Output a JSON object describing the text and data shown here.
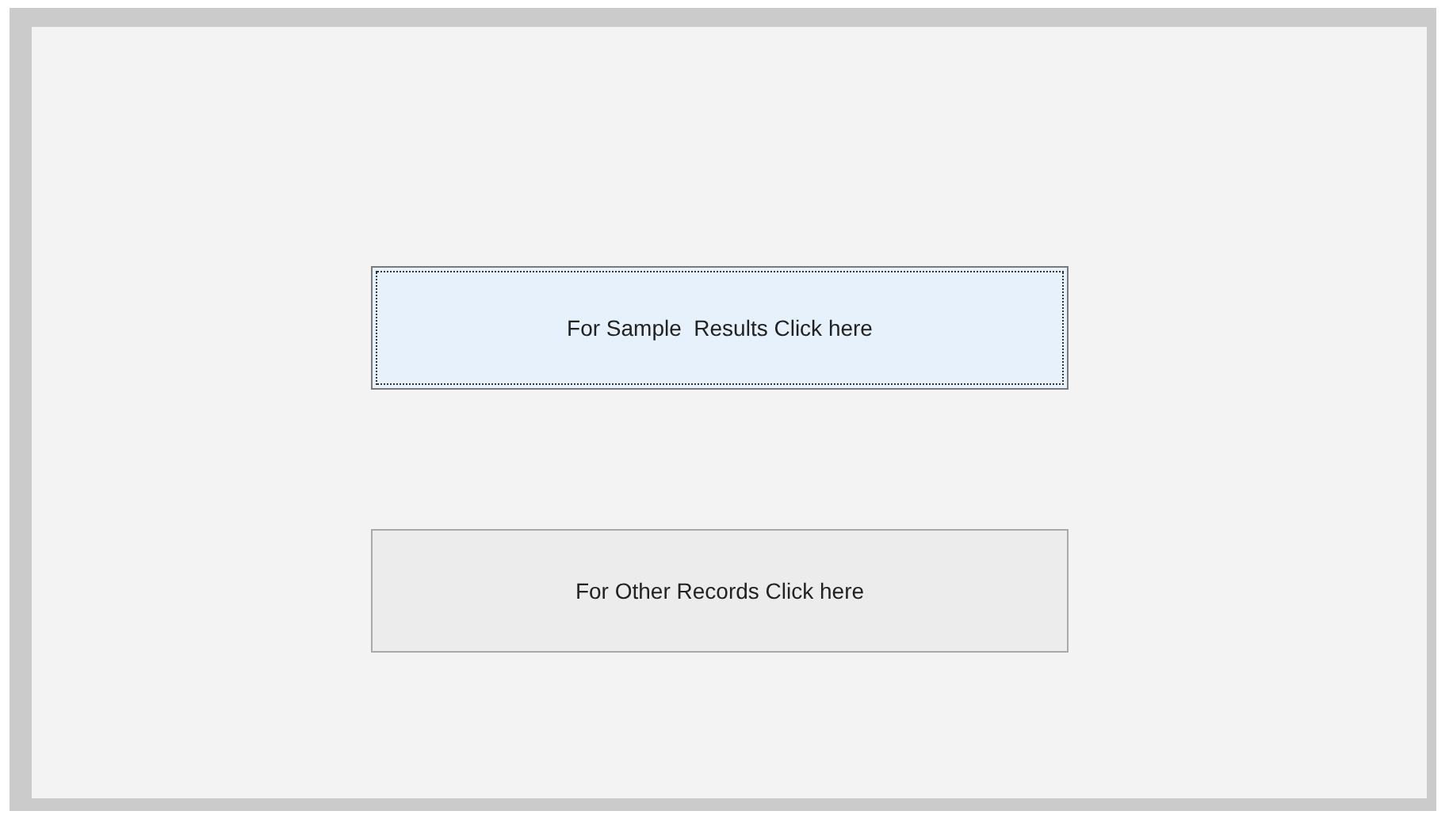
{
  "buttons": [
    {
      "label": "For Sample  Results Click here",
      "focused": true
    },
    {
      "label": "For Other Records Click here",
      "focused": false
    }
  ]
}
